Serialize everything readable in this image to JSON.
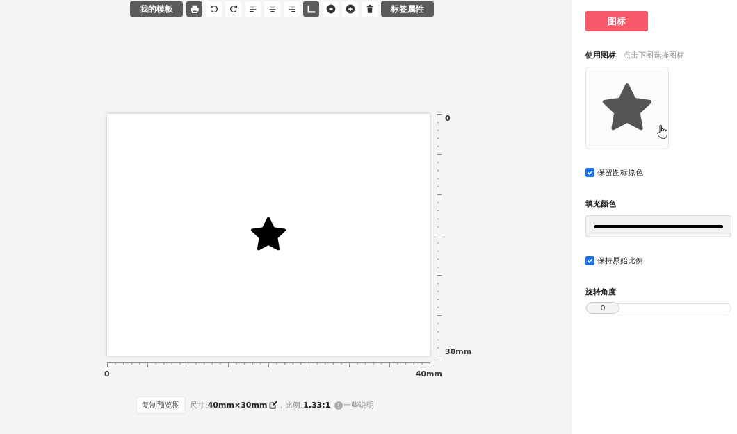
{
  "toolbar": [
    {
      "kind": "text",
      "label": "我的模板"
    },
    {
      "kind": "print",
      "selected": true
    },
    {
      "kind": "undo",
      "selected": false
    },
    {
      "kind": "redo",
      "selected": false
    },
    {
      "kind": "alignleft",
      "selected": false
    },
    {
      "kind": "aligncenter",
      "selected": false
    },
    {
      "kind": "alignright",
      "selected": false
    },
    {
      "kind": "corner",
      "selected": true
    },
    {
      "kind": "zoomout",
      "selected": false
    },
    {
      "kind": "zoomin",
      "selected": false
    },
    {
      "kind": "trash",
      "selected": false
    },
    {
      "kind": "text",
      "label": "标签属性"
    }
  ],
  "canvas": {
    "vertical_ruler": {
      "start": "0",
      "end": "30mm"
    },
    "horizontal_ruler": {
      "start": "0",
      "end": "40mm"
    }
  },
  "info_bar": {
    "copy_button": "复制预览图",
    "size": "尺寸:**40mm×30mm**",
    "ratio": "，比例:**1.33:1**",
    "note": "一些说明"
  },
  "panel": {
    "tab": "图标",
    "icon_label": "使用图标",
    "icon_hint": "点击下图选择图标",
    "keep_color": {
      "label": "保留图标原色",
      "checked": true
    },
    "fill": {
      "label": "填充颜色",
      "color": "#000000"
    },
    "keep_ratio": {
      "label": "保持原始比例",
      "checked": true
    },
    "rotate_label": "旋转角度",
    "rotate": {
      "value": "0",
      "level": 0
    }
  }
}
